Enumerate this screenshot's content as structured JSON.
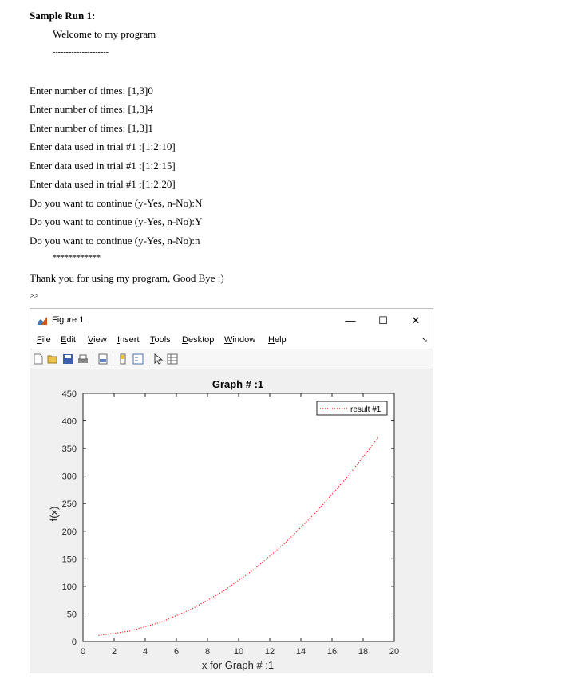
{
  "document": {
    "heading": "Sample Run 1:",
    "welcome": "Welcome to my program",
    "dashes": "---------------------",
    "lines": [
      "Enter number of times: [1,3]0",
      "Enter number of times: [1,3]4",
      "Enter number of times: [1,3]1",
      "Enter data used in trial #1 :[1:2:10]",
      "Enter data used in trial #1 :[1:2:15]",
      "Enter data used in trial #1 :[1:2:20]",
      "Do you want to continue (y-Yes, n-No):N",
      "Do you want to continue (y-Yes, n-No):Y",
      "Do you want to continue (y-Yes, n-No):n"
    ],
    "stars": "************",
    "goodbye": "Thank you for using my program, Good Bye :)",
    "prompt": ">>"
  },
  "figure_window": {
    "title": "Figure 1",
    "minimize": "—",
    "maximize": "☐",
    "close": "✕",
    "menu": [
      {
        "label": "File",
        "key": "F",
        "rest": "ile"
      },
      {
        "label": "Edit",
        "key": "E",
        "rest": "dit"
      },
      {
        "label": "View",
        "key": "V",
        "rest": "iew"
      },
      {
        "label": "Insert",
        "key": "I",
        "rest": "nsert"
      },
      {
        "label": "Tools",
        "key": "T",
        "rest": "ools"
      },
      {
        "label": "Desktop",
        "key": "D",
        "rest": "esktop"
      },
      {
        "label": "Window",
        "key": "W",
        "rest": "indow"
      },
      {
        "label": "Help",
        "key": "H",
        "rest": "elp"
      }
    ],
    "toolbar_icons": [
      "new-figure-icon",
      "open-file-icon",
      "save-icon",
      "print-icon",
      "print-preview-icon",
      "colorbar-icon",
      "legend-icon",
      "pointer-icon",
      "property-editor-icon"
    ]
  },
  "chart_data": {
    "type": "line",
    "title": "Graph # :1",
    "xlabel": "x for Graph # :1",
    "ylabel": "f(x)",
    "xlim": [
      0,
      20
    ],
    "ylim": [
      0,
      450
    ],
    "xticks": [
      0,
      2,
      4,
      6,
      8,
      10,
      12,
      14,
      16,
      18,
      20
    ],
    "yticks": [
      0,
      50,
      100,
      150,
      200,
      250,
      300,
      350,
      400,
      450
    ],
    "legend_position": "top-right",
    "series": [
      {
        "name": "result #1",
        "color": "#ff0000",
        "line_style": "dotted",
        "x": [
          1,
          3,
          5,
          7,
          9,
          11,
          13,
          15,
          17,
          19
        ],
        "y": [
          11,
          19,
          35,
          59,
          91,
          131,
          179,
          235,
          299,
          371
        ]
      }
    ]
  }
}
